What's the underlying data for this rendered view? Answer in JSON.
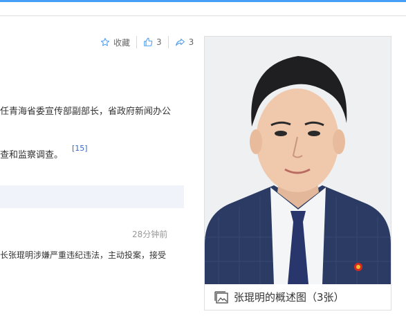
{
  "actions": {
    "favorite_label": "收藏",
    "like_count": "3",
    "share_count": "3"
  },
  "article": {
    "line1": "任青海省委宣传部副部长，省政府新闻办公",
    "line2": "查和监察调查。",
    "ref": "[15]"
  },
  "news": {
    "time": "28分钟前",
    "text": "长张琨明涉嫌严重违纪违法，主动投案，接受"
  },
  "photo": {
    "caption": "张琨明的概述图（3张）"
  },
  "colors": {
    "accent": "#459df5",
    "link": "#3366cc"
  }
}
